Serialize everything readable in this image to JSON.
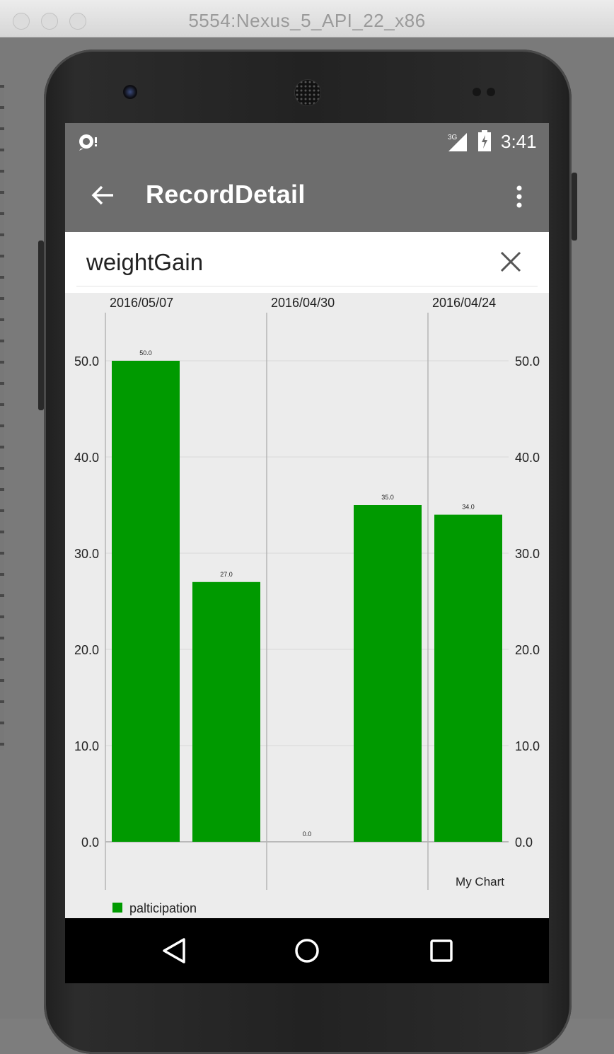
{
  "window": {
    "title": "5554:Nexus_5_API_22_x86"
  },
  "status_bar": {
    "time": "3:41",
    "network": "3G",
    "left_icon": "debug-icon"
  },
  "toolbar": {
    "title": "RecordDetail",
    "back_icon": "arrow-back-icon",
    "overflow_icon": "more-vert-icon"
  },
  "header": {
    "title": "weightGain",
    "close_icon": "close-icon"
  },
  "chart_data": {
    "type": "bar",
    "categories": [
      "2016/05/07",
      "",
      "2016/04/30",
      "",
      "2016/04/24"
    ],
    "x_top_labels": [
      "2016/05/07",
      "2016/04/30",
      "2016/04/24"
    ],
    "series": [
      {
        "name": "palticipation",
        "values": [
          50.0,
          27.0,
          0.0,
          35.0,
          34.0
        ],
        "value_labels": [
          "50.0",
          "27.0",
          "0.0",
          "35.0",
          "34.0"
        ],
        "color": "#009a00"
      }
    ],
    "y_ticks": [
      "0.0",
      "10.0",
      "20.0",
      "30.0",
      "40.0",
      "50.0"
    ],
    "ylim": [
      0,
      50
    ],
    "axes": "dual-y (left and right)",
    "grid": true,
    "legend": "bottom-left",
    "description": "My Chart"
  },
  "nav_bar": {
    "back": "back-triangle-icon",
    "home": "home-circle-icon",
    "recents": "recents-square-icon"
  }
}
